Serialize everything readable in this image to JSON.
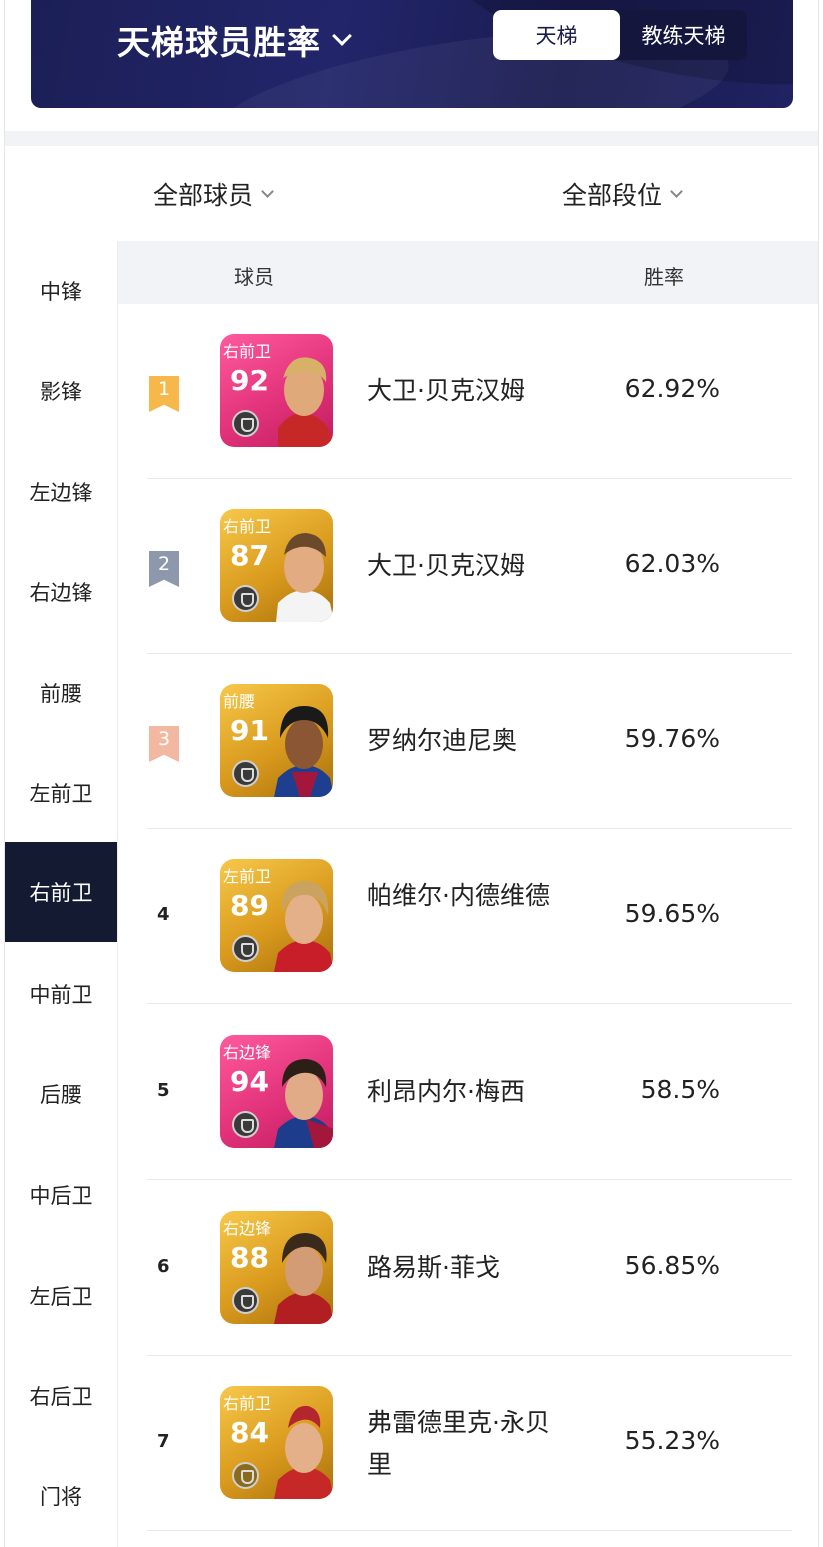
{
  "header": {
    "title": "天梯球员胜率",
    "tabs": [
      {
        "label": "天梯",
        "active": true
      },
      {
        "label": "教练天梯",
        "active": false
      }
    ]
  },
  "filters": {
    "players": "全部球员",
    "tier": "全部段位"
  },
  "sidebar": {
    "items": [
      {
        "label": "中锋"
      },
      {
        "label": "影锋"
      },
      {
        "label": "左边锋"
      },
      {
        "label": "右边锋"
      },
      {
        "label": "前腰"
      },
      {
        "label": "左前卫"
      },
      {
        "label": "右前卫",
        "active": true
      },
      {
        "label": "中前卫"
      },
      {
        "label": "后腰"
      },
      {
        "label": "中后卫"
      },
      {
        "label": "左后卫"
      },
      {
        "label": "右后卫"
      },
      {
        "label": "门将"
      }
    ]
  },
  "table": {
    "columns": [
      "球员",
      "胜率"
    ],
    "rows": [
      {
        "rank": "1",
        "position": "右前卫",
        "rating": "92",
        "name": "大卫·贝克汉姆",
        "win_rate": "62.92%",
        "card": "pink",
        "flag_color": "#f6b84b"
      },
      {
        "rank": "2",
        "position": "右前卫",
        "rating": "87",
        "name": "大卫·贝克汉姆",
        "win_rate": "62.03%",
        "card": "gold",
        "flag_color": "#8e98ad"
      },
      {
        "rank": "3",
        "position": "前腰",
        "rating": "91",
        "name": "罗纳尔迪尼奥",
        "win_rate": "59.76%",
        "card": "gold",
        "flag_color": "#f2b8a2"
      },
      {
        "rank": "4",
        "position": "左前卫",
        "rating": "89",
        "name": "帕维尔·内德维德",
        "win_rate": "59.65%",
        "card": "gold"
      },
      {
        "rank": "5",
        "position": "右边锋",
        "rating": "94",
        "name": "利昂内尔·梅西",
        "win_rate": "58.5%",
        "card": "pink"
      },
      {
        "rank": "6",
        "position": "右边锋",
        "rating": "88",
        "name": "路易斯·菲戈",
        "win_rate": "56.85%",
        "card": "gold"
      },
      {
        "rank": "7",
        "position": "右前卫",
        "rating": "84",
        "name": "弗雷德里克·永贝里",
        "win_rate": "55.23%",
        "card": "gold"
      }
    ]
  }
}
